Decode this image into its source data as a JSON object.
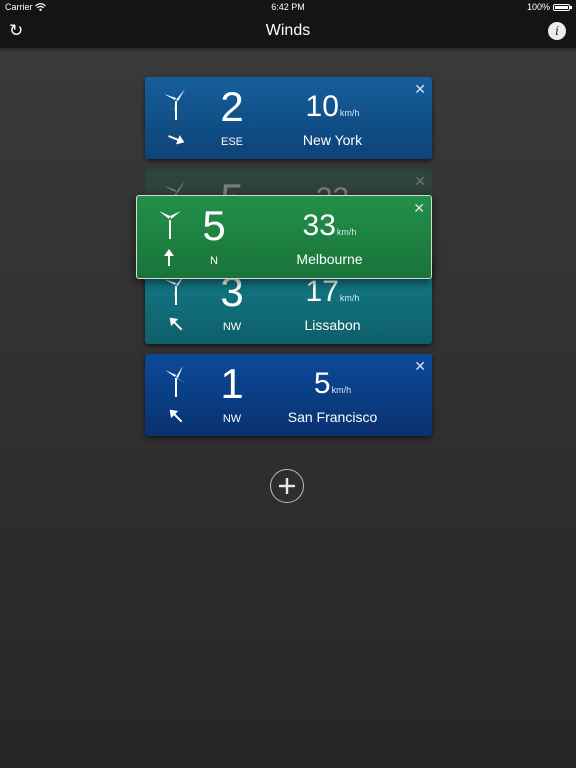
{
  "status_bar": {
    "carrier": "Carrier",
    "time": "6:42 PM",
    "battery": "100%",
    "battery_level": 1.0
  },
  "nav": {
    "title": "Winds",
    "refresh_icon": "refresh-icon",
    "info_label": "i"
  },
  "cards": [
    {
      "beaufort": "2",
      "direction": "ESE",
      "speed": "10",
      "unit": "km/h",
      "city": "New York",
      "close": "✕",
      "color": "#125696"
    },
    {
      "beaufort": "5",
      "direction": "",
      "speed": "33",
      "unit": "",
      "city": "",
      "close": "✕",
      "color": "#1f5f4a"
    },
    {
      "beaufort": "5",
      "direction": "N",
      "speed": "33",
      "unit": "km/h",
      "city": "Melbourne",
      "close": "✕",
      "color": "#228c46"
    },
    {
      "beaufort": "3",
      "direction": "NW",
      "speed": "17",
      "unit": "km/h",
      "city": "Lissabon",
      "close": "",
      "color": "#137c88"
    },
    {
      "beaufort": "1",
      "direction": "NW",
      "speed": "5",
      "unit": "km/h",
      "city": "San Francisco",
      "close": "✕",
      "color": "#0b4496"
    }
  ],
  "add_button": {
    "icon": "plus-icon"
  }
}
